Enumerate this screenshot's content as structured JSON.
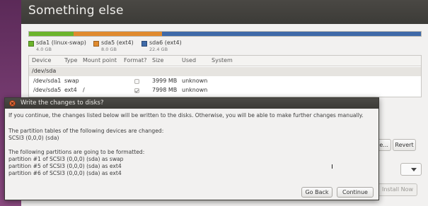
{
  "installer": {
    "title": "Something else",
    "partitions": [
      {
        "label": "sda1 (linux-swap)",
        "size": "4.0 GB",
        "color": "#6cb42c",
        "fraction": 0.113
      },
      {
        "label": "sda5 (ext4)",
        "size": "8.0 GB",
        "color": "#e08a2e",
        "fraction": 0.226
      },
      {
        "label": "sda6 (ext4)",
        "size": "22.4 GB",
        "color": "#3f6aa8",
        "fraction": 0.661
      }
    ],
    "table": {
      "headers": [
        "Device",
        "Type",
        "Mount point",
        "Format?",
        "Size",
        "Used",
        "System"
      ],
      "rows": [
        {
          "device": "/dev/sda",
          "type": "",
          "mount": "",
          "format": null,
          "size": "",
          "used": "",
          "system": ""
        },
        {
          "device": "/dev/sda1",
          "type": "swap",
          "mount": "",
          "format": false,
          "size": "3999 MB",
          "used": "unknown",
          "system": ""
        },
        {
          "device": "/dev/sda5",
          "type": "ext4",
          "mount": "/",
          "format": true,
          "size": "7998 MB",
          "used": "unknown",
          "system": ""
        }
      ]
    },
    "change_button_label": "ble...",
    "revert_button_label": "Revert",
    "install_now_label": "Install Now"
  },
  "dialog": {
    "title": "Write the changes to disks?",
    "intro": "If you continue, the changes listed below will be written to the disks. Otherwise, you will be able to make further changes manually.",
    "tables_heading": "The partition tables of the following devices are changed:",
    "tables_devices": [
      " SCSI3 (0,0,0) (sda)"
    ],
    "format_heading": "The following partitions are going to be formatted:",
    "format_list": [
      " partition #1 of SCSI3 (0,0,0) (sda) as swap",
      " partition #5 of SCSI3 (0,0,0) (sda) as ext4",
      " partition #6 of SCSI3 (0,0,0) (sda) as ext4"
    ],
    "go_back_label": "Go Back",
    "continue_label": "Continue"
  }
}
